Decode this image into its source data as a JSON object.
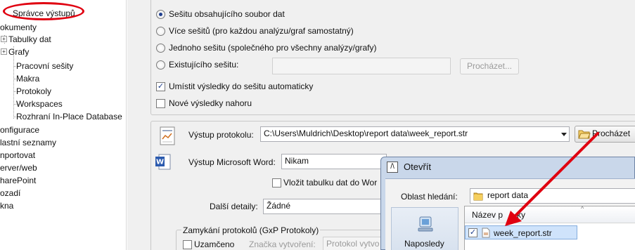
{
  "tree": {
    "items": [
      {
        "label": "Správce výstupů",
        "has_expander": false
      },
      {
        "label": "okumenty",
        "has_expander": false
      },
      {
        "label": "Tabulky dat",
        "has_expander": true
      },
      {
        "label": "Grafy",
        "has_expander": true
      },
      {
        "label": "Pracovní sešity",
        "has_expander": false
      },
      {
        "label": "Makra",
        "has_expander": false
      },
      {
        "label": "Protokoly",
        "has_expander": false
      },
      {
        "label": "Workspaces",
        "has_expander": false
      },
      {
        "label": "Rozhraní In-Place Database",
        "has_expander": false
      },
      {
        "label": "onfigurace",
        "has_expander": false
      },
      {
        "label": "lastní seznamy",
        "has_expander": false
      },
      {
        "label": "nportovat",
        "has_expander": false
      },
      {
        "label": "erver/web",
        "has_expander": false
      },
      {
        "label": "harePoint",
        "has_expander": false
      },
      {
        "label": "ozadí",
        "has_expander": false
      },
      {
        "label": "kna",
        "has_expander": false
      }
    ],
    "expander_symbol": "+"
  },
  "output": {
    "radio_options": [
      {
        "label": "Sešitu obsahujícího soubor dat",
        "selected": true
      },
      {
        "label": "Více sešitů (pro každou analýzu/graf samostatný)",
        "selected": false
      },
      {
        "label": "Jednoho sešitu (společného pro všechny analýzy/grafy)",
        "selected": false
      },
      {
        "label": "Existujícího sešitu:",
        "selected": false
      }
    ],
    "existing_workbook_value": "",
    "browse_label": "Procházet...",
    "checkboxes": [
      {
        "label": "Umístit výsledky do sešitu automaticky",
        "checked": true
      },
      {
        "label": "Nové výsledky nahoru",
        "checked": false
      }
    ]
  },
  "report": {
    "output_label": "Výstup protokolu:",
    "output_path": "C:\\Users\\Muldrich\\Desktop\\report data\\week_report.str",
    "browse_label": "Procházet",
    "word_label": "Výstup Microsoft Word:",
    "word_value": "Nikam",
    "embed_checkbox_label": "Vložit tabulku dat do Wor",
    "embed_checked": false,
    "details_label": "Další detaily:",
    "details_value": "Žádné",
    "lock_group_label": "Zamykání protokolů (GxP Protokoly)",
    "locked_label": "Uzamčeno",
    "locked_checked": false,
    "creation_mark_label": "Značka vytvoření:",
    "creation_mark_value": "Protokol vytvo"
  },
  "dialog": {
    "title": "Otevřít",
    "look_in_label": "Oblast hledání:",
    "look_in_value": "report data",
    "column_name": "Název p",
    "column_name_tail": "ky",
    "file_name": "week_report.str",
    "file_checked": true,
    "place_label": "Naposledy"
  },
  "colors": {
    "annotation_red": "#e00010",
    "selection_blue": "#cfe3fb"
  }
}
